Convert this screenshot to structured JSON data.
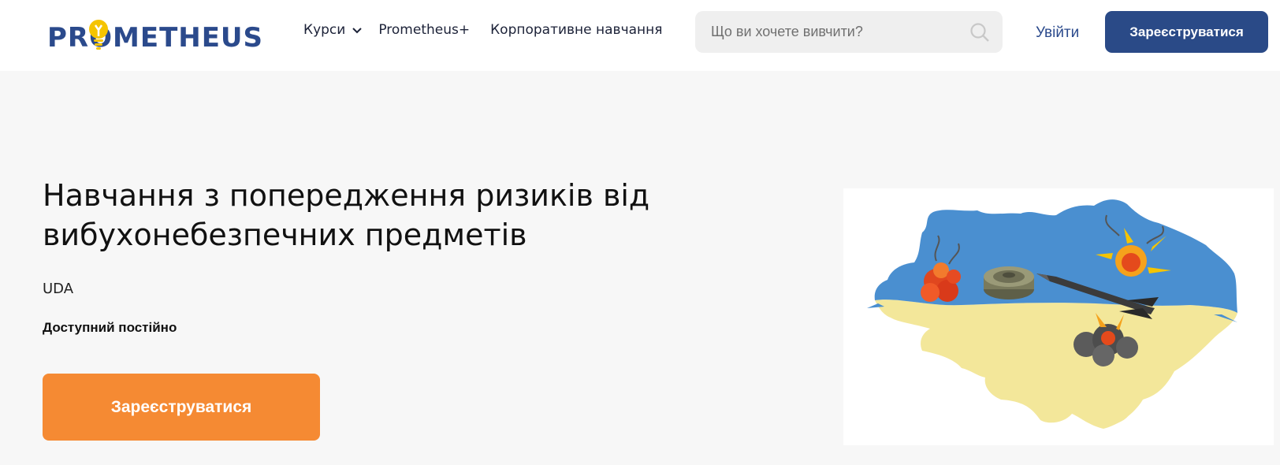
{
  "header": {
    "logo_text": "PROMETHEUS",
    "nav": {
      "courses_label": "Курси",
      "plus_label": "Prometheus+",
      "corporate_label": "Корпоративне навчання"
    },
    "search": {
      "placeholder": "Що ви хочете вивчити?",
      "icon": "search-icon"
    },
    "login_label": "Увійти",
    "signup_label": "Зареєструватися"
  },
  "hero": {
    "title": "Навчання з попередження ризиків від вибухонебезпечних предметів",
    "organization": "UDA",
    "availability": "Доступний постійно",
    "signup_label": "Зареєструватися"
  },
  "colors": {
    "brand_blue": "#2a4a87",
    "accent_orange": "#f58a33",
    "logo_yellow": "#f5c400",
    "map_blue": "#4a8fd0",
    "map_yellow": "#f3e79a"
  }
}
